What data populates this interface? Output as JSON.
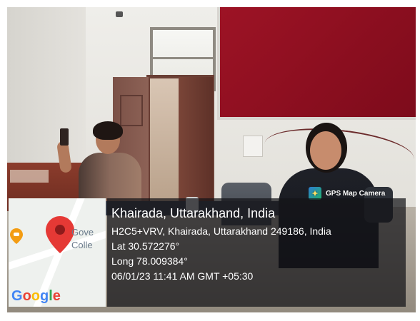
{
  "badge": {
    "label": "GPS Map Camera",
    "icon": "gps-map-camera-icon"
  },
  "map": {
    "label_line1": "Gove",
    "label_line2": "Colle",
    "brand": [
      "G",
      "o",
      "o",
      "g",
      "l",
      "e"
    ],
    "pin_icon": "map-pin-icon",
    "food_icon": "food-marker-icon"
  },
  "location": {
    "title": "Khairada, Uttarakhand, India",
    "address": "H2C5+VRV, Khairada, Uttarakhand 249186, India",
    "lat": "Lat 30.572276°",
    "long": "Long 78.009384°",
    "datetime": "06/01/23 11:41 AM GMT +05:30"
  },
  "colors": {
    "board": "#8d1020",
    "panel": "#141418",
    "pin": "#e53935"
  }
}
